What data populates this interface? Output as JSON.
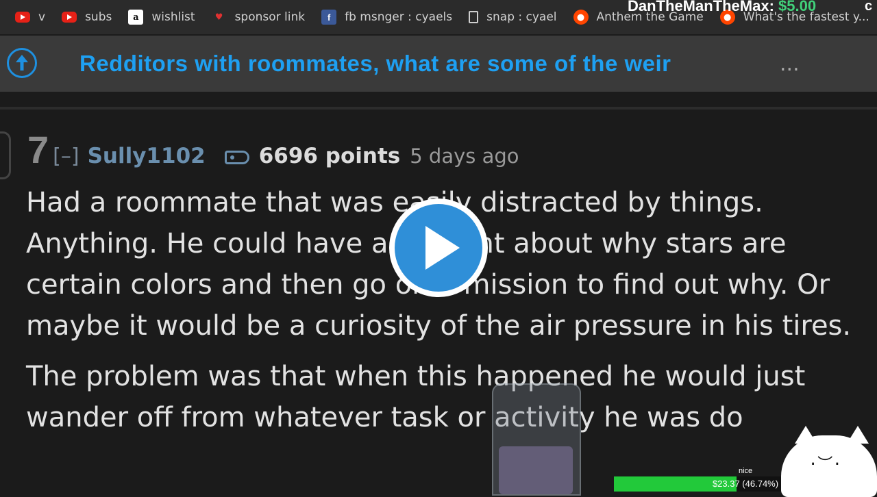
{
  "bookmarks": [
    {
      "label": "v",
      "icon": "youtube-icon"
    },
    {
      "label": "subs",
      "icon": "youtube-icon"
    },
    {
      "label": "wishlist",
      "icon": "amazon-icon"
    },
    {
      "label": "sponsor link",
      "icon": "heart-icon"
    },
    {
      "label": "fb msnger : cyaels",
      "icon": "facebook-icon"
    },
    {
      "label": "snap : cyael",
      "icon": "page-icon"
    },
    {
      "label": "Anthem the Game",
      "icon": "reddit-icon"
    },
    {
      "label": "What's the fastest y...",
      "icon": "reddit-icon"
    }
  ],
  "donation": {
    "name": "DanTheManTheMax:",
    "amount": "$5.00",
    "cut": "c"
  },
  "thread": {
    "title": "Redditors with roommates, what are some of the weir",
    "ellipsis": "..."
  },
  "comment": {
    "depth": "7",
    "collapse": "[–]",
    "author": "Sully1102",
    "points": "6696 points",
    "time": "5 days ago",
    "paragraphs": [
      "Had a roommate that was easily distracted by things. Anything. He could have a thought about why stars are certain colors and then go on a mission to find out why. Or maybe it would be a curiosity of the air pressure in his tires.",
      "The problem was that when this happened he would just wander off from whatever task or activity he was do"
    ]
  },
  "goal": {
    "label": "nice",
    "text": "$23.37 (46.74%)",
    "progress": 0.4674
  },
  "cat": {
    "face": "·︶·"
  },
  "colors": {
    "accent": "#1ea0f2",
    "author": "#6a8fae",
    "goal": "#22c93a"
  }
}
